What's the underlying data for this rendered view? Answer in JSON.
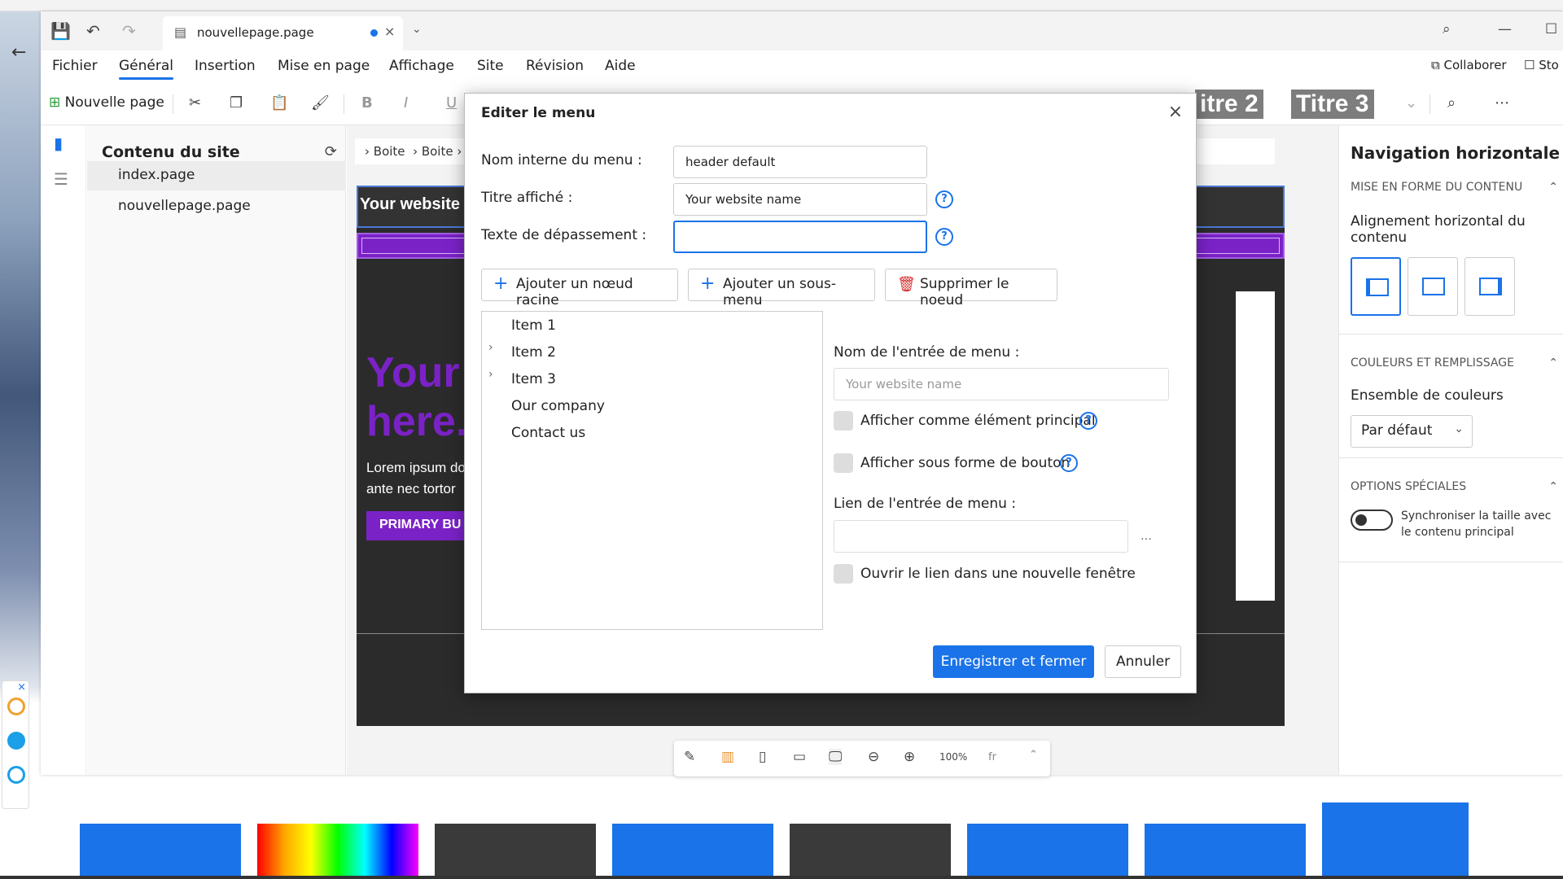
{
  "titlebar": {
    "tab_name": "nouvellepage.page"
  },
  "menubar": {
    "items": [
      "Fichier",
      "Général",
      "Insertion",
      "Mise en page",
      "Affichage",
      "Site",
      "Révision",
      "Aide"
    ],
    "active": "Général",
    "collaborate": "Collaborer",
    "store": "Sto"
  },
  "ribbon": {
    "new_page": "Nouvelle page",
    "bold": "B",
    "italic": "I",
    "underline": "U",
    "titre2": "itre 2",
    "titre3": "Titre 3"
  },
  "site_panel": {
    "title": "Contenu du site",
    "pages": [
      "index.page",
      "nouvellepage.page"
    ]
  },
  "canvas": {
    "breadcrumb": [
      "Boite",
      "Boite"
    ],
    "site_name": "Your website",
    "hero_line1": "Your",
    "hero_line2": "here.",
    "lorem_line1": "Lorem ipsum do",
    "lorem_line2": "ante nec tortor",
    "primary_button": "PRIMARY BU"
  },
  "bottom_toolbar": {
    "zoom": "100%",
    "language": "fr"
  },
  "right_panel": {
    "title": "Navigation horizontale",
    "section1": "MISE EN FORME DU CONTENU",
    "align_label": "Alignement horizontal du contenu",
    "section2": "COULEURS ET REMPLISSAGE",
    "color_label": "Ensemble de couleurs",
    "color_value": "Par défaut",
    "section3": "OPTIONS SPÉCIALES",
    "sync_label": "Synchroniser la taille avec le contenu principal"
  },
  "modal": {
    "title": "Editer le menu",
    "internal_name_label": "Nom interne du menu :",
    "internal_name_value": "header default",
    "display_title_label": "Titre affiché :",
    "display_title_value": "Your website name",
    "overflow_label": "Texte de dépassement :",
    "overflow_value": "",
    "add_root": "Ajouter un nœud racine",
    "add_submenu": "Ajouter un sous-menu",
    "delete_node": "Supprimer le noeud",
    "tree": [
      {
        "label": "Item 1",
        "expandable": false
      },
      {
        "label": "Item 2",
        "expandable": true
      },
      {
        "label": "Item 3",
        "expandable": true
      },
      {
        "label": "Our company",
        "expandable": false
      },
      {
        "label": "Contact us",
        "expandable": false
      }
    ],
    "entry_name_label": "Nom de l'entrée de menu :",
    "entry_name_placeholder": "Your website name",
    "show_main_label": "Afficher comme élément principal",
    "show_button_label": "Afficher sous forme de bouton",
    "entry_link_label": "Lien de l'entrée de menu :",
    "open_new_window_label": "Ouvrir le lien dans une nouvelle fenêtre",
    "save_close": "Enregistrer et fermer",
    "cancel": "Annuler"
  },
  "colors": {
    "accent": "#1a73e8",
    "brand_purple": "#7b22c7",
    "delete_red": "#d42c2c"
  }
}
